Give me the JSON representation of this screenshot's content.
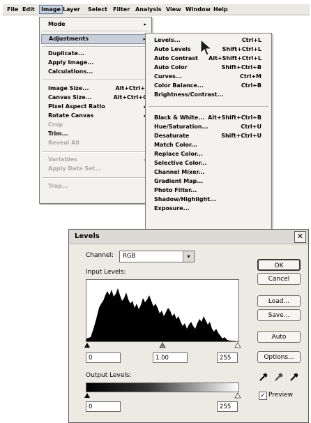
{
  "menubar": {
    "items": [
      "File",
      "Edit",
      "Image",
      "Layer",
      "Select",
      "Filter",
      "Analysis",
      "View",
      "Window",
      "Help"
    ]
  },
  "image_menu": {
    "items": [
      {
        "label": "Mode",
        "arrow": "▸"
      },
      {
        "label": "Adjustments",
        "arrow": "▸"
      },
      {
        "label": "Duplicate..."
      },
      {
        "label": "Apply Image..."
      },
      {
        "label": "Calculations..."
      },
      {
        "label": "Image Size...",
        "shortcut": "Alt+Ctrl+I"
      },
      {
        "label": "Canvas Size...",
        "shortcut": "Alt+Ctrl+C"
      },
      {
        "label": "Pixel Aspect Ratio",
        "arrow": "▸"
      },
      {
        "label": "Rotate Canvas",
        "arrow": "▸"
      },
      {
        "label": "Crop"
      },
      {
        "label": "Trim..."
      },
      {
        "label": "Reveal All"
      },
      {
        "label": "Variables",
        "arrow": "▸"
      },
      {
        "label": "Apply Data Set..."
      },
      {
        "label": "Trap..."
      }
    ]
  },
  "adjustments_menu": {
    "items": [
      {
        "label": "Levels...",
        "shortcut": "Ctrl+L"
      },
      {
        "label": "Auto Levels",
        "shortcut": "Shift+Ctrl+L"
      },
      {
        "label": "Auto Contrast",
        "shortcut": "Alt+Shift+Ctrl+L"
      },
      {
        "label": "Auto Color",
        "shortcut": "Shift+Ctrl+B"
      },
      {
        "label": "Curves...",
        "shortcut": "Ctrl+M"
      },
      {
        "label": "Color Balance...",
        "shortcut": "Ctrl+B"
      },
      {
        "label": "Brightness/Contrast..."
      },
      {
        "label": "Black & White...",
        "shortcut": "Alt+Shift+Ctrl+B"
      },
      {
        "label": "Hue/Saturation...",
        "shortcut": "Ctrl+U"
      },
      {
        "label": "Desaturate",
        "shortcut": "Shift+Ctrl+U"
      },
      {
        "label": "Match Color..."
      },
      {
        "label": "Replace Color..."
      },
      {
        "label": "Selective Color..."
      },
      {
        "label": "Channel Mixer..."
      },
      {
        "label": "Gradient Map..."
      },
      {
        "label": "Photo Filter..."
      },
      {
        "label": "Shadow/Highlight..."
      },
      {
        "label": "Exposure..."
      }
    ]
  },
  "levels_dialog": {
    "title": "Levels",
    "close": "✕",
    "channel_label": "Channel:",
    "channel_value": "RGB",
    "input_levels_label": "Input Levels:",
    "input_black": "0",
    "input_gamma": "1.00",
    "input_white": "255",
    "output_levels_label": "Output Levels:",
    "output_black": "0",
    "output_white": "255",
    "buttons": {
      "ok": "OK",
      "cancel": "Cancel",
      "load": "Load...",
      "save": "Save...",
      "auto": "Auto",
      "options": "Options..."
    },
    "preview_label": "Preview",
    "preview_checked": true
  }
}
